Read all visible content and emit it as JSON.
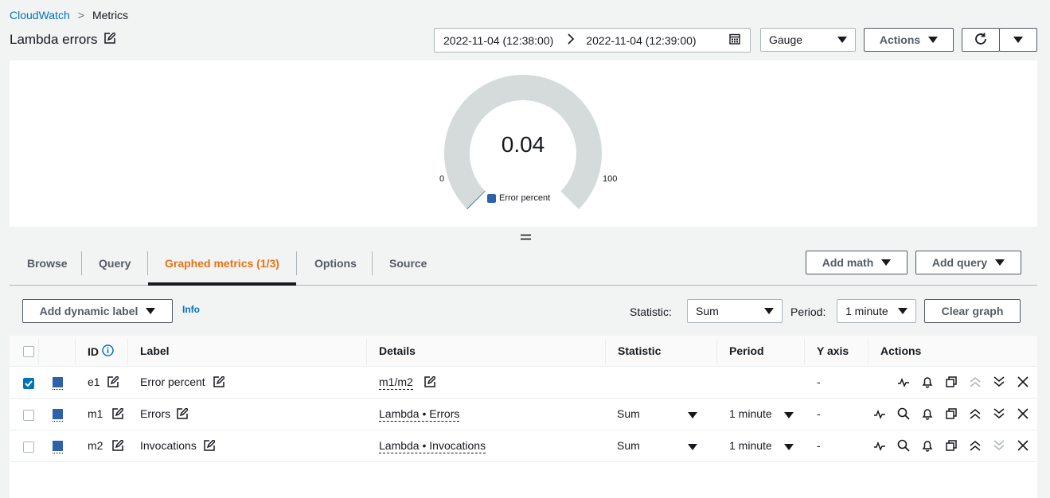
{
  "breadcrumb": {
    "root": "CloudWatch",
    "current": "Metrics"
  },
  "page": {
    "title": "Lambda errors"
  },
  "header": {
    "time_start": "2022-11-04 (12:38:00)",
    "time_end": "2022-11-04 (12:39:00)",
    "view_type": "Gauge",
    "actions_label": "Actions"
  },
  "gauge": {
    "value_label": "0.04",
    "value": 0.04,
    "min_label": "0",
    "max_label": "100",
    "legend": "Error percent",
    "color": "#2e62a8"
  },
  "tabs": [
    {
      "label": "Browse"
    },
    {
      "label": "Query"
    },
    {
      "label": "Graphed metrics (1/3)"
    },
    {
      "label": "Options"
    },
    {
      "label": "Source"
    }
  ],
  "tab_buttons": {
    "add_math": "Add math",
    "add_query": "Add query"
  },
  "toolbar": {
    "dynamic_label": "Add dynamic label",
    "info": "Info",
    "statistic_label": "Statistic:",
    "statistic_value": "Sum",
    "period_label": "Period:",
    "period_value": "1 minute",
    "clear_graph": "Clear graph"
  },
  "table": {
    "headers": {
      "id": "ID",
      "label": "Label",
      "details": "Details",
      "statistic": "Statistic",
      "period": "Period",
      "yaxis": "Y axis",
      "actions": "Actions"
    },
    "rows": [
      {
        "checked": true,
        "id": "e1",
        "label": "Error percent",
        "details": "m1/m2",
        "statistic": "",
        "period": "",
        "yaxis": "-"
      },
      {
        "checked": false,
        "id": "m1",
        "label": "Errors",
        "details": "Lambda • Errors",
        "statistic": "Sum",
        "period": "1 minute",
        "yaxis": "-"
      },
      {
        "checked": false,
        "id": "m2",
        "label": "Invocations",
        "details": "Lambda • Invocations",
        "statistic": "Sum",
        "period": "1 minute",
        "yaxis": "-"
      }
    ]
  }
}
